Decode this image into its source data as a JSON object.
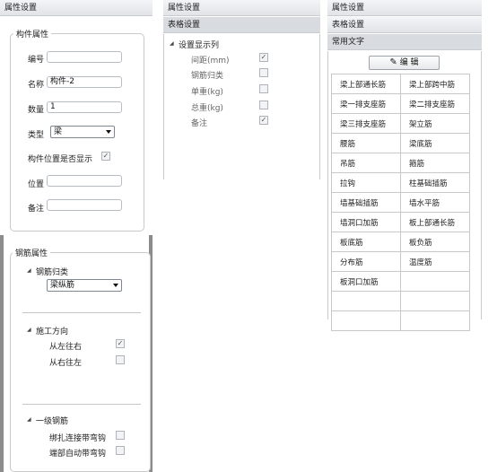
{
  "panel1": {
    "header": "属性设置",
    "component_group": {
      "title": "构件属性",
      "fields": {
        "number_label": "编号",
        "number_value": "",
        "name_label": "名称",
        "name_value": "构件-2",
        "quantity_label": "数量",
        "quantity_value": "1",
        "type_label": "类型",
        "type_value": "梁",
        "show_position_label": "构件位置是否显示",
        "show_position_checked": true,
        "position_label": "位置",
        "position_value": "",
        "note_label": "备注",
        "note_value": ""
      }
    },
    "rebar_group": {
      "title": "钢筋属性",
      "category_label": "钢筋归类",
      "category_value": "梁纵筋",
      "direction_label": "施工方向",
      "left_to_right_label": "从左往右",
      "left_to_right_checked": true,
      "right_to_left_label": "从右往左",
      "right_to_left_checked": false,
      "primary_label": "一级钢筋",
      "binding_hook_label": "绑扎连接带弯钩",
      "binding_hook_checked": false,
      "end_hook_label": "端部自动带弯钩",
      "end_hook_checked": false
    }
  },
  "panel2": {
    "header1": "属性设置",
    "header2": "表格设置",
    "section_label": "设置显示列",
    "columns": [
      {
        "label": "间距(mm)",
        "checked": true
      },
      {
        "label": "钢筋归类",
        "checked": false
      },
      {
        "label": "单重(kg)",
        "checked": false
      },
      {
        "label": "总重(kg)",
        "checked": false
      },
      {
        "label": "备注",
        "checked": true
      }
    ]
  },
  "panel3": {
    "header1": "属性设置",
    "header2": "表格设置",
    "header3": "常用文字",
    "edit_button": "编 辑",
    "rows": [
      [
        "梁上部通长筋",
        "梁上部跨中筋"
      ],
      [
        "梁一排支座筋",
        "梁二排支座筋"
      ],
      [
        "梁三排支座筋",
        "架立筋"
      ],
      [
        "腰筋",
        "梁底筋"
      ],
      [
        "吊筋",
        "箍筋"
      ],
      [
        "拉钩",
        "柱基础插筋"
      ],
      [
        "墙基础插筋",
        "墙水平筋"
      ],
      [
        "墙洞口加筋",
        "板上部通长筋"
      ],
      [
        "板底筋",
        "板负筋"
      ],
      [
        "分布筋",
        "温度筋"
      ],
      [
        "板洞口加筋",
        ""
      ],
      [
        "",
        ""
      ],
      [
        "",
        ""
      ]
    ]
  }
}
